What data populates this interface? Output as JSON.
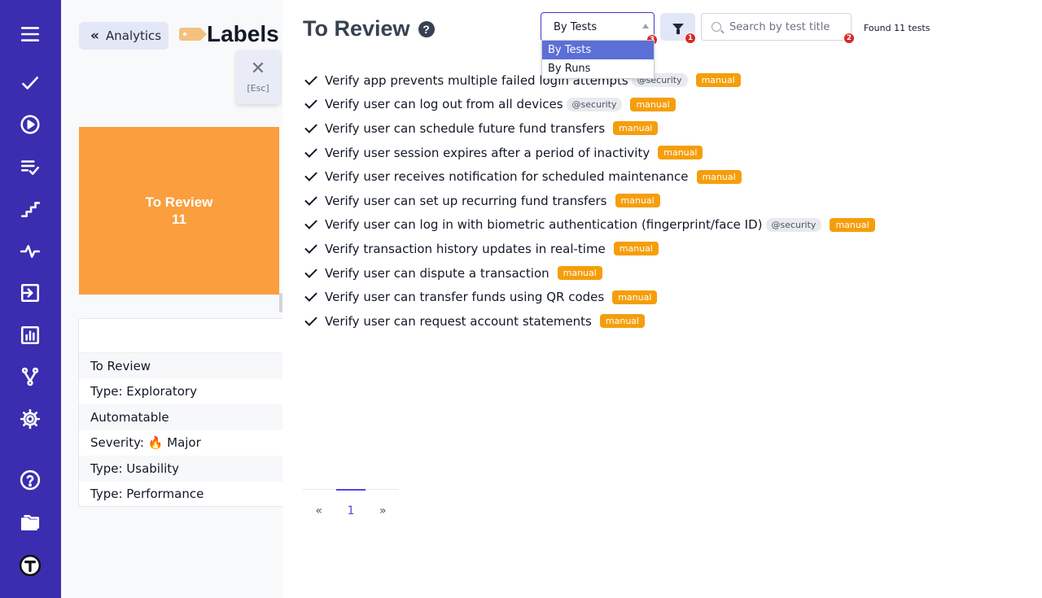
{
  "rail": {
    "icons": [
      "menu-icon",
      "check-icon",
      "play-circle-icon",
      "list-check-icon",
      "steps-icon",
      "pulse-icon",
      "import-icon",
      "bar-chart-icon",
      "branch-icon",
      "gear-icon",
      "help-circle-icon",
      "folder-icon",
      "logo-icon"
    ]
  },
  "sidebar": {
    "back_label": "Analytics",
    "title": "Labels",
    "close_hint": "[Esc]",
    "card": {
      "label": "To Review",
      "count": "11",
      "color": "#fa9e3e"
    },
    "labels": [
      "To Review",
      "Type: Exploratory",
      "Automatable",
      "Severity: 🔥 Major",
      "Type: Usability",
      "Type: Performance"
    ]
  },
  "main": {
    "title": "To Review",
    "select": {
      "value": "By Tests",
      "options": [
        "By Tests",
        "By Runs"
      ],
      "badge": "3"
    },
    "filter_badge": "1",
    "search": {
      "placeholder": "Search by test title",
      "badge": "2"
    },
    "found": "Found 11 tests",
    "tests": [
      {
        "title": "Verify app prevents multiple failed login attempts",
        "tags": [
          "@security"
        ],
        "type": "manual"
      },
      {
        "title": "Verify user can log out from all devices",
        "tags": [
          "@security"
        ],
        "type": "manual"
      },
      {
        "title": "Verify user can schedule future fund transfers",
        "tags": [],
        "type": "manual"
      },
      {
        "title": "Verify user session expires after a period of inactivity",
        "tags": [],
        "type": "manual"
      },
      {
        "title": "Verify user receives notification for scheduled maintenance",
        "tags": [],
        "type": "manual"
      },
      {
        "title": "Verify user can set up recurring fund transfers",
        "tags": [],
        "type": "manual"
      },
      {
        "title": "Verify user can log in with biometric authentication (fingerprint/face ID)",
        "tags": [
          "@security"
        ],
        "type": "manual"
      },
      {
        "title": "Verify transaction history updates in real-time",
        "tags": [],
        "type": "manual"
      },
      {
        "title": "Verify user can dispute a transaction",
        "tags": [],
        "type": "manual"
      },
      {
        "title": "Verify user can transfer funds using QR codes",
        "tags": [],
        "type": "manual"
      },
      {
        "title": "Verify user can request account statements",
        "tags": [],
        "type": "manual"
      }
    ],
    "pagination": {
      "prev": "«",
      "current": "1",
      "next": "»"
    }
  },
  "colors": {
    "rail": "#3a2db0",
    "accent": "#4338ca",
    "manual_tag": "#f59e0b",
    "badge": "#dc2626"
  }
}
